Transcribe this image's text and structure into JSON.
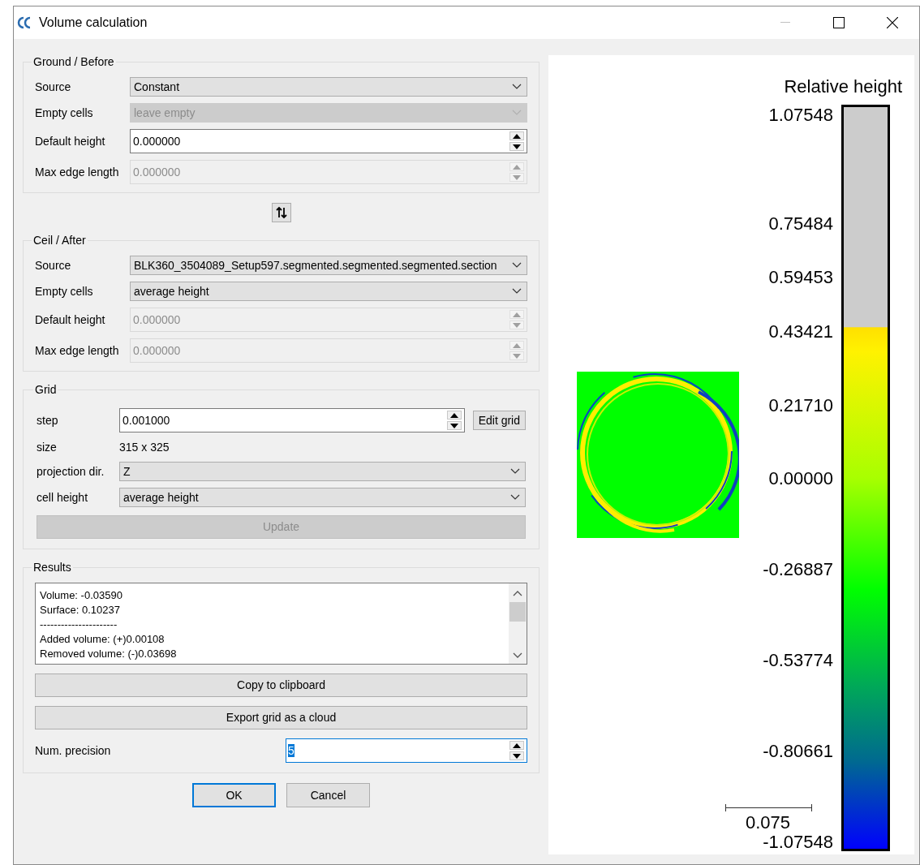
{
  "window": {
    "title": "Volume calculation"
  },
  "ground": {
    "title": "Ground / Before",
    "fields": [
      {
        "label": "Source",
        "kind": "combo",
        "value": "Constant",
        "disabled": false
      },
      {
        "label": "Empty cells",
        "kind": "combo",
        "value": "leave empty",
        "disabled": true
      },
      {
        "label": "Default height",
        "kind": "spin",
        "value": "0.000000",
        "disabled": false
      },
      {
        "label": "Max edge length",
        "kind": "spin",
        "value": "0.000000",
        "disabled": true
      }
    ]
  },
  "ceil": {
    "title": "Ceil / After",
    "fields": [
      {
        "label": "Source",
        "kind": "combo",
        "value": "BLK360_3504089_Setup597.segmented.segmented.segmented.section",
        "disabled": false
      },
      {
        "label": "Empty cells",
        "kind": "combo",
        "value": "average height",
        "disabled": false
      },
      {
        "label": "Default height",
        "kind": "spin",
        "value": "0.000000",
        "disabled": true
      },
      {
        "label": "Max edge length",
        "kind": "spin",
        "value": "0.000000",
        "disabled": true
      }
    ]
  },
  "grid": {
    "title": "Grid",
    "step": {
      "label": "step",
      "value": "0.001000"
    },
    "edit_button": "Edit grid",
    "size": {
      "label": "size",
      "value": "315 x 325"
    },
    "fields": [
      {
        "label": "projection dir.",
        "kind": "combo",
        "value": "Z",
        "disabled": false
      },
      {
        "label": "cell height",
        "kind": "combo",
        "value": "average height",
        "disabled": false
      }
    ],
    "update": {
      "label": "Update",
      "disabled": true
    }
  },
  "results": {
    "title": "Results",
    "lines": [
      "Volume: -0.03590",
      "Surface: 0.10237",
      "----------------------",
      "Added volume: (+)0.00108",
      "Removed volume: (-)0.03698"
    ],
    "buttons": [
      "Copy to clipboard",
      "Export grid as a cloud"
    ],
    "precision": {
      "label": "Num. precision",
      "value": "5",
      "focused": true
    }
  },
  "footer": {
    "buttons": [
      {
        "label": "OK",
        "default": true
      },
      {
        "label": "Cancel",
        "default": false
      }
    ]
  },
  "view": {
    "scale_title": "Relative height",
    "scale_labels": [
      "1.07548",
      "0.75484",
      "0.59453",
      "0.43421",
      "0.21710",
      "0.00000",
      "-0.26887",
      "-0.53774",
      "-0.80661",
      "-1.07548"
    ],
    "scale_bar_label": "0.075"
  }
}
